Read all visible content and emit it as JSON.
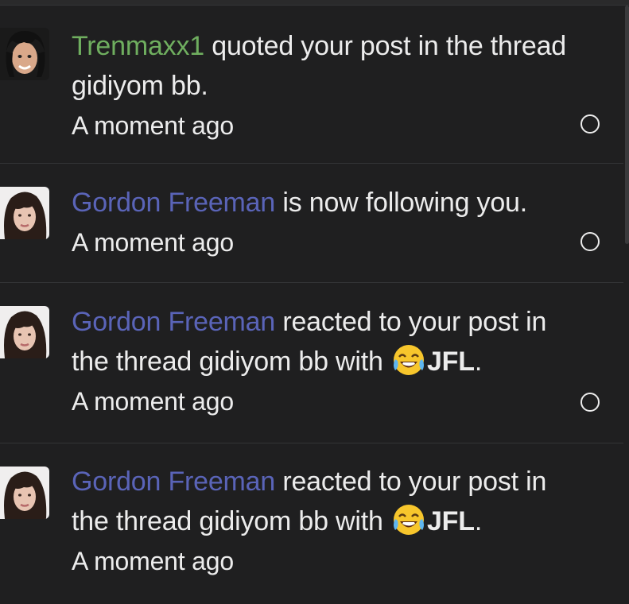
{
  "notifications": [
    {
      "user": "Trenmaxx1",
      "text": " quoted your post in the thread gidiyom bb.",
      "time": "A moment ago",
      "avatar": "avatar-trenmaxx1"
    },
    {
      "user": "Gordon Freeman",
      "text": " is now following you.",
      "time": "A moment ago",
      "avatar": "avatar-gordon-freeman"
    },
    {
      "user": "Gordon Freeman",
      "text": " reacted to your post in the thread gidiyom bb with ",
      "reaction": "JFL",
      "reaction_emoji": "laughing-crying-emoji",
      "text_end": ".",
      "time": "A moment ago",
      "avatar": "avatar-gordon-freeman"
    },
    {
      "user": "Gordon Freeman",
      "text": " reacted to your post in the thread gidiyom bb with ",
      "reaction": "JFL",
      "reaction_emoji": "laughing-crying-emoji",
      "text_end": ".",
      "time": "A moment ago",
      "avatar": "avatar-gordon-freeman"
    }
  ],
  "colors": {
    "background": "#1f1f20",
    "text": "#ececec",
    "user_green": "#6fae5f",
    "user_blue": "#5a64b8",
    "divider": "#333436"
  }
}
